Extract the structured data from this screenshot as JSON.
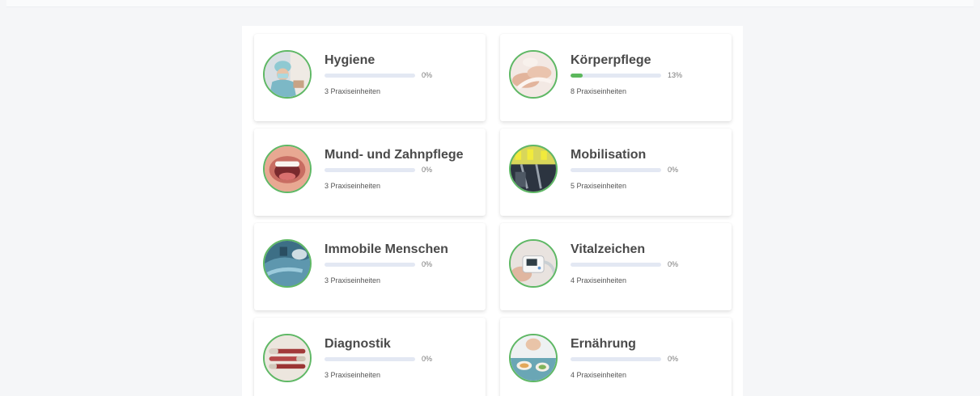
{
  "courses": [
    {
      "title": "Hygiene",
      "progress_label": "0%",
      "progress": 0,
      "units": "3 Praxiseinheiten",
      "image": "nurse-hygiene-photo"
    },
    {
      "title": "Körperpflege",
      "progress_label": "13%",
      "progress": 13,
      "units": "8 Praxiseinheiten",
      "image": "hand-care-photo"
    },
    {
      "title": "Mund- und Zahnpflege",
      "progress_label": "0%",
      "progress": 0,
      "units": "3 Praxiseinheiten",
      "image": "open-mouth-photo"
    },
    {
      "title": "Mobilisation",
      "progress_label": "0%",
      "progress": 0,
      "units": "5 Praxiseinheiten",
      "image": "mobility-equipment-photo"
    },
    {
      "title": "Immobile Menschen",
      "progress_label": "0%",
      "progress": 0,
      "units": "3 Praxiseinheiten",
      "image": "bedridden-patient-photo"
    },
    {
      "title": "Vitalzeichen",
      "progress_label": "0%",
      "progress": 0,
      "units": "4 Praxiseinheiten",
      "image": "blood-pressure-monitor-photo"
    },
    {
      "title": "Diagnostik",
      "progress_label": "0%",
      "progress": 0,
      "units": "3 Praxiseinheiten",
      "image": "blood-sample-tubes-photo"
    },
    {
      "title": "Ernährung",
      "progress_label": "0%",
      "progress": 0,
      "units": "4 Praxiseinheiten",
      "image": "meal-tray-photo"
    }
  ],
  "colors": {
    "accent": "#5cb85c",
    "track": "#e3e8f3",
    "page_bg": "#f5f6f8"
  }
}
